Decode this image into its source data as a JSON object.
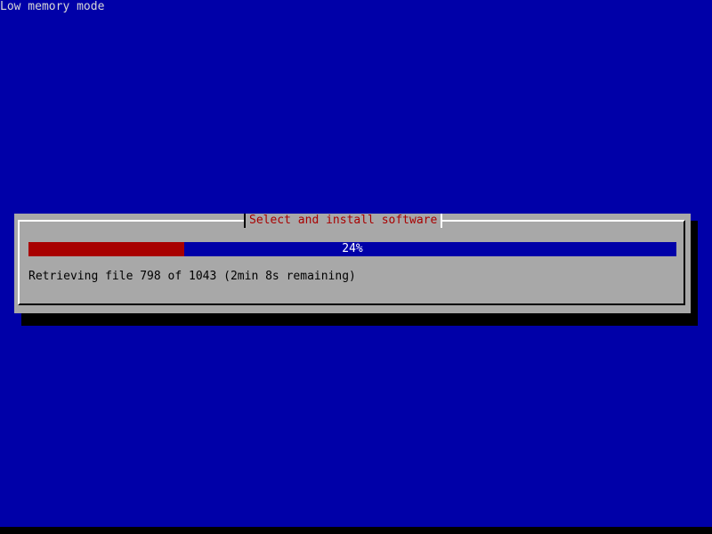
{
  "screen": {
    "mode_label": "Low memory mode"
  },
  "dialog": {
    "title": "Select and install software",
    "progress": {
      "percent": 24,
      "label": "24%"
    },
    "status": "Retrieving file 798 of 1043 (2min 8s remaining)"
  },
  "colors": {
    "background": "#0000a8",
    "dialog_bg": "#a8a8a8",
    "title_text": "#a80000",
    "progress_fill": "#a80000",
    "progress_track": "#0000a8"
  }
}
